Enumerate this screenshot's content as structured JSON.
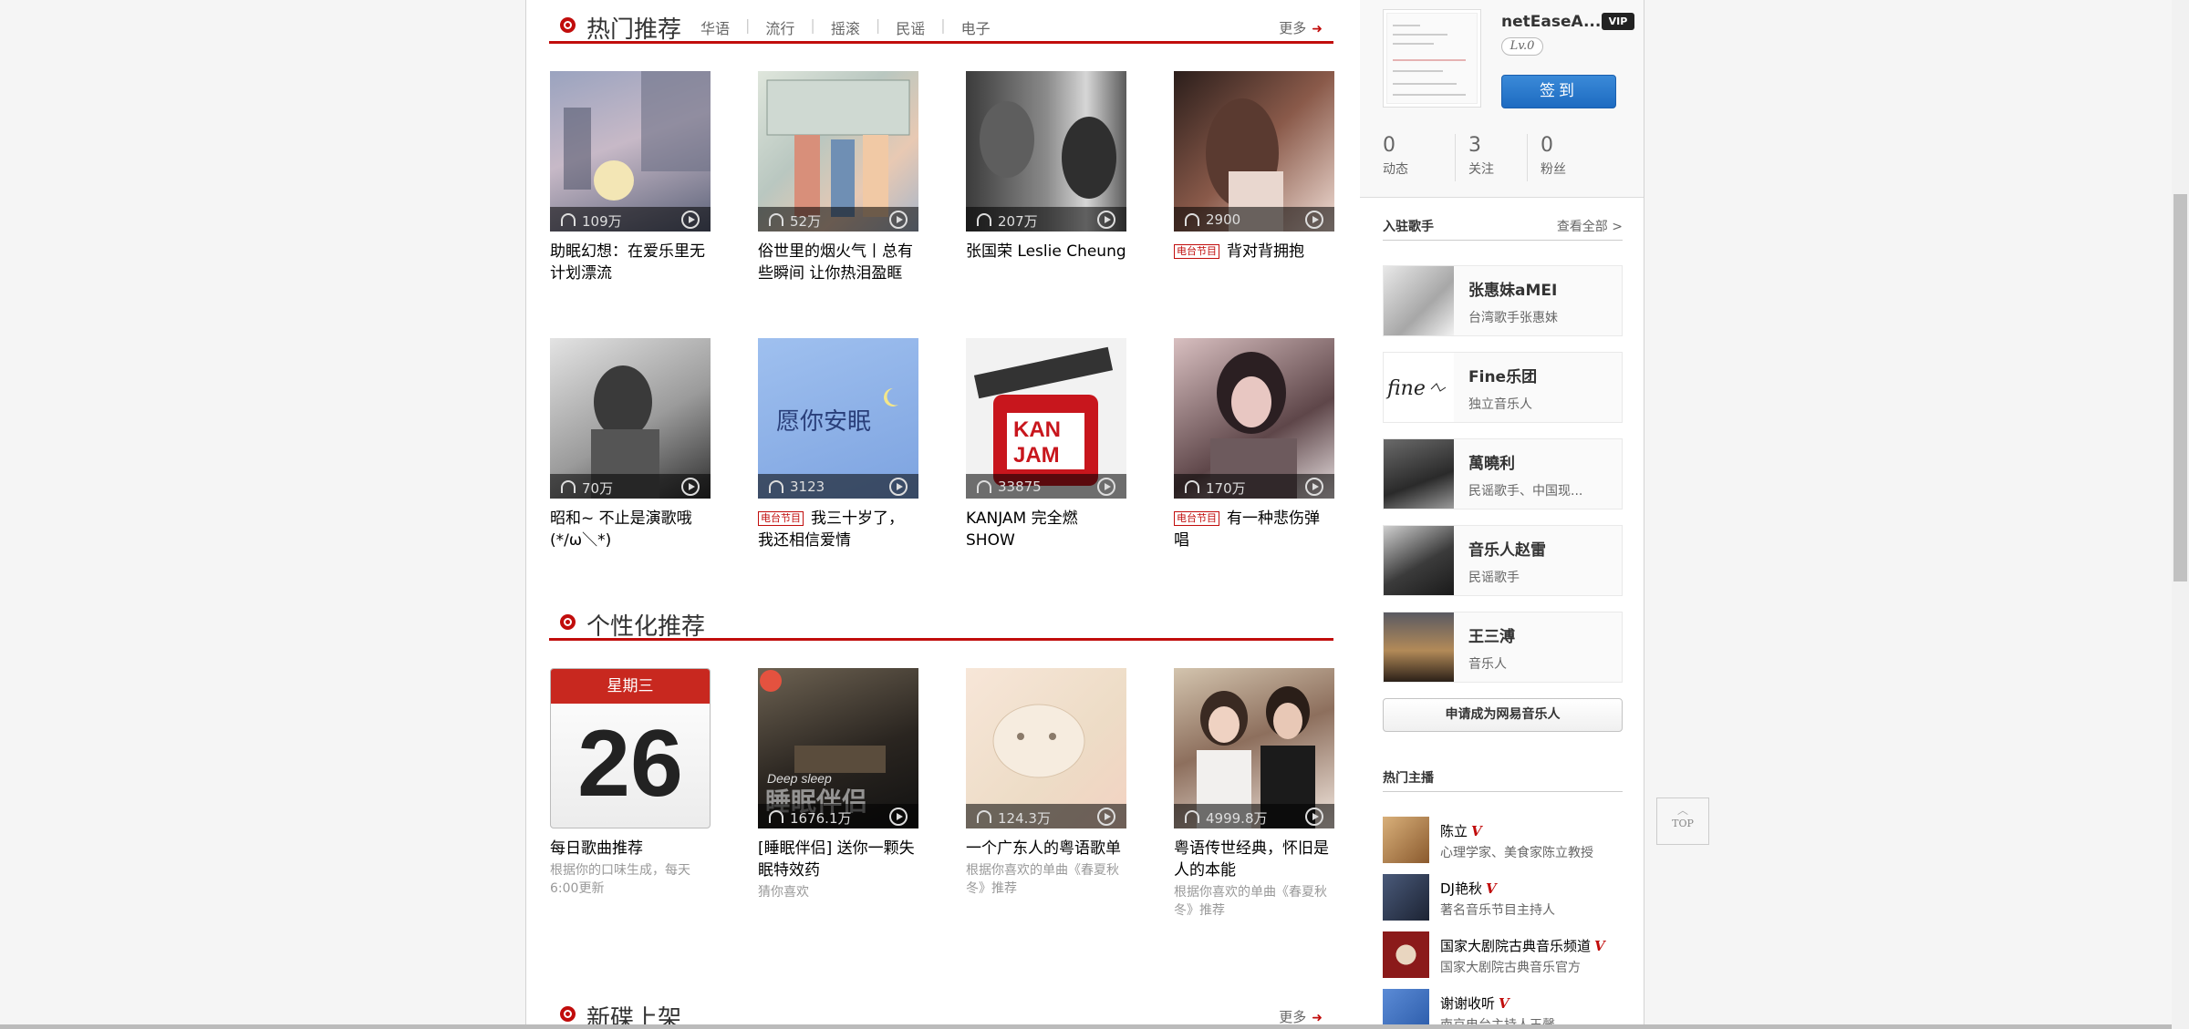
{
  "hot": {
    "title": "热门推荐",
    "tabs": [
      "华语",
      "流行",
      "摇滚",
      "民谣",
      "电子"
    ],
    "more": "更多",
    "playlists": [
      {
        "count": "109万",
        "name": "助眠幻想：在爱乐里无计划漂流",
        "radio": false
      },
      {
        "count": "52万",
        "name": "俗世里的烟火气丨总有些瞬间 让你热泪盈眶",
        "radio": false
      },
      {
        "count": "207万",
        "name": "张国荣 Leslie Cheung",
        "radio": false
      },
      {
        "count": "2900",
        "name": "背对背拥抱",
        "radio": true
      },
      {
        "count": "70万",
        "name": "昭和~ 不止是演歌哦 (*/ω＼*)",
        "radio": false
      },
      {
        "count": "3123",
        "name": "我三十岁了，我还相信爱情",
        "radio": true
      },
      {
        "count": "33875",
        "name": "KANJAM 完全燃SHOW",
        "radio": false
      },
      {
        "count": "170万",
        "name": "有一种悲伤弹唱",
        "radio": true
      }
    ]
  },
  "radio_tag": "电台节目",
  "personal": {
    "title": "个性化推荐",
    "calendar": {
      "weekday": "星期三",
      "day": "26"
    },
    "items": [
      {
        "name": "每日歌曲推荐",
        "desc": "根据你的口味生成，每天6:00更新",
        "count": ""
      },
      {
        "name": "[睡眠伴侣] 送你一颗失眠特效药",
        "desc": "猜你喜欢",
        "count": "1676.1万",
        "cover_text_en": "Deep sleep",
        "cover_text_cn": "睡眠伴侣"
      },
      {
        "name": "一个广东人的粤语歌单",
        "desc": "根据你喜欢的单曲《春夏秋冬》推荐",
        "count": "124.3万"
      },
      {
        "name": "粤语传世经典，怀旧是人的本能",
        "desc": "根据你喜欢的单曲《春夏秋冬》推荐",
        "count": "4999.8万"
      }
    ]
  },
  "newalbum": {
    "title": "新碟上架",
    "more": "更多"
  },
  "user": {
    "name": "netEaseA...",
    "vip": "VIP",
    "level": "Lv.0",
    "sign": "签到",
    "stats": [
      {
        "num": "0",
        "label": "动态"
      },
      {
        "num": "3",
        "label": "关注"
      },
      {
        "num": "0",
        "label": "粉丝"
      }
    ]
  },
  "singers": {
    "title": "入驻歌手",
    "more": "查看全部 >",
    "items": [
      {
        "name": "张惠妹aMEI",
        "desc": "台湾歌手张惠妹"
      },
      {
        "name": "Fine乐团",
        "desc": "独立音乐人",
        "logo_text": "fine"
      },
      {
        "name": "萬曉利",
        "desc": "民谣歌手、中国现..."
      },
      {
        "name": "音乐人赵雷",
        "desc": "民谣歌手"
      },
      {
        "name": "王三溥",
        "desc": "音乐人"
      }
    ],
    "apply": "申请成为网易音乐人"
  },
  "anchors": {
    "title": "热门主播",
    "items": [
      {
        "name": "陈立",
        "desc": "心理学家、美食家陈立教授"
      },
      {
        "name": "DJ艳秋",
        "desc": "著名音乐节目主持人"
      },
      {
        "name": "国家大剧院古典音乐频道",
        "desc": "国家大剧院古典音乐官方"
      },
      {
        "name": "谢谢收听",
        "desc": "南京电台主持人王馨"
      }
    ],
    "verified_mark": "V"
  },
  "top_button": "TOP"
}
